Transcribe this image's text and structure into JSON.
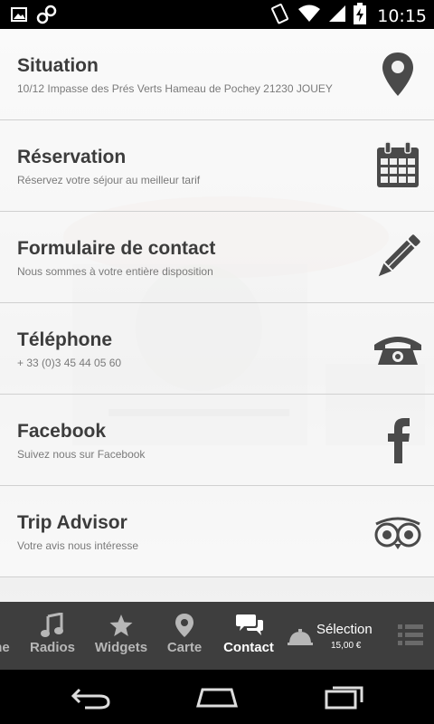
{
  "status_bar": {
    "time": "10:15",
    "icons": [
      "image-icon",
      "link-icon",
      "rotate-icon",
      "wifi-icon",
      "signal-icon",
      "battery-charging-icon"
    ]
  },
  "rows": [
    {
      "title": "Situation",
      "subtitle": "10/12 Impasse des Prés Verts Hameau de Pochey 21230 JOUEY",
      "icon": "map-pin-icon"
    },
    {
      "title": "Réservation",
      "subtitle": "Réservez votre séjour au meilleur tarif",
      "icon": "calendar-icon"
    },
    {
      "title": "Formulaire de contact",
      "subtitle": "Nous sommes à votre entière disposition",
      "icon": "pencil-icon"
    },
    {
      "title": "Téléphone",
      "subtitle": "+ 33 (0)3 45 44 05 60",
      "icon": "phone-icon"
    },
    {
      "title": "Facebook",
      "subtitle": "Suivez nous sur Facebook",
      "icon": "facebook-icon"
    },
    {
      "title": "Trip Advisor",
      "subtitle": "Votre avis nous intéresse",
      "icon": "tripadvisor-icon"
    }
  ],
  "bottom_nav": {
    "partial_label": "ne",
    "items": [
      {
        "label": "Radios",
        "icon": "music-note-icon"
      },
      {
        "label": "Widgets",
        "icon": "star-icon"
      },
      {
        "label": "Carte",
        "icon": "map-pin-icon"
      },
      {
        "label": "Contact",
        "icon": "chat-bubbles-icon",
        "active": true
      }
    ],
    "selection": {
      "title": "Sélection",
      "price": "15,00 €",
      "icon": "cloche-icon"
    },
    "menu_icon": "list-icon"
  },
  "system_nav": [
    "back-icon",
    "home-icon",
    "recents-icon"
  ],
  "colors": {
    "nav_bg": "#3e3e3e",
    "row_title": "#3c3c3c",
    "row_subtitle": "#7a7a7a",
    "icon": "#4a4a4a"
  }
}
